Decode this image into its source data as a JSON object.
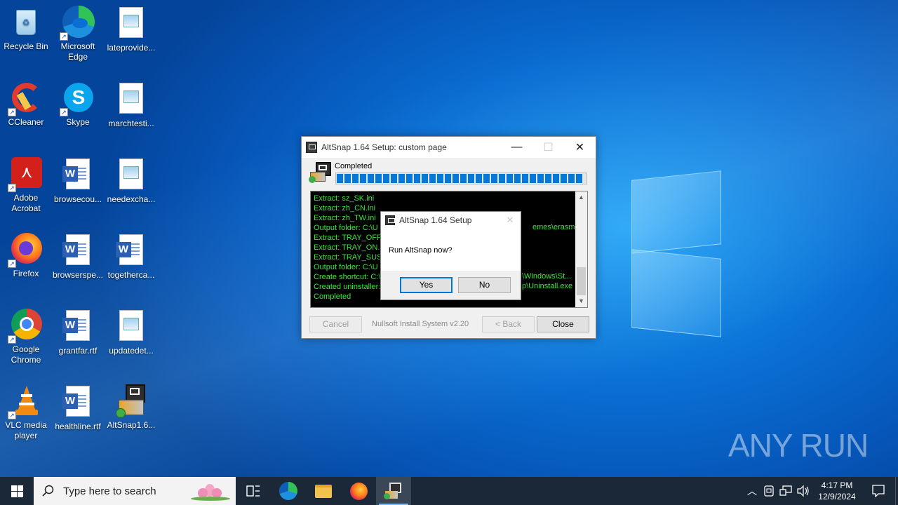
{
  "desktop": {
    "icons": [
      {
        "label": "Recycle Bin"
      },
      {
        "label": "Microsoft Edge"
      },
      {
        "label": "lateprovide..."
      },
      {
        "label": "CCleaner"
      },
      {
        "label": "Skype"
      },
      {
        "label": "marchtesti..."
      },
      {
        "label": "Adobe Acrobat"
      },
      {
        "label": "browsecou..."
      },
      {
        "label": "needexcha..."
      },
      {
        "label": "Firefox"
      },
      {
        "label": "browserspe..."
      },
      {
        "label": "togetherca..."
      },
      {
        "label": "Google Chrome"
      },
      {
        "label": "grantfar.rtf"
      },
      {
        "label": "updatedet..."
      },
      {
        "label": "VLC media player"
      },
      {
        "label": "healthline.rtf"
      },
      {
        "label": "AltSnap1.6..."
      }
    ],
    "watermark": "ANY RUN"
  },
  "setup_window": {
    "title": "AltSnap 1.64 Setup: custom page",
    "status": "Completed",
    "progress_percent": 100,
    "log_lines": [
      "Extract: sz_SK.ini",
      "Extract: zh_CN.ini",
      "Extract: zh_TW.ini",
      "Output folder: C:\\U",
      "Extract: TRAY_OFF",
      "Extract: TRAY_ON.i",
      "Extract: TRAY_SUS.",
      "Output folder: C:\\U",
      "Create shortcut: C:\\",
      "Created uninstaller:",
      "Completed"
    ],
    "log_right_fragments": {
      "line4": "emes\\erasmion",
      "line9": "\\Windows\\St...",
      "line10": "p\\Uninstall.exe"
    },
    "buttons": {
      "cancel": "Cancel",
      "back": "< Back",
      "close": "Close"
    },
    "branding": "Nullsoft Install System v2.20"
  },
  "prompt_dialog": {
    "title": "AltSnap 1.64 Setup",
    "message": "Run AltSnap now?",
    "yes": "Yes",
    "no": "No"
  },
  "taskbar": {
    "search_placeholder": "Type here to search",
    "time": "4:17 PM",
    "date": "12/9/2024"
  }
}
